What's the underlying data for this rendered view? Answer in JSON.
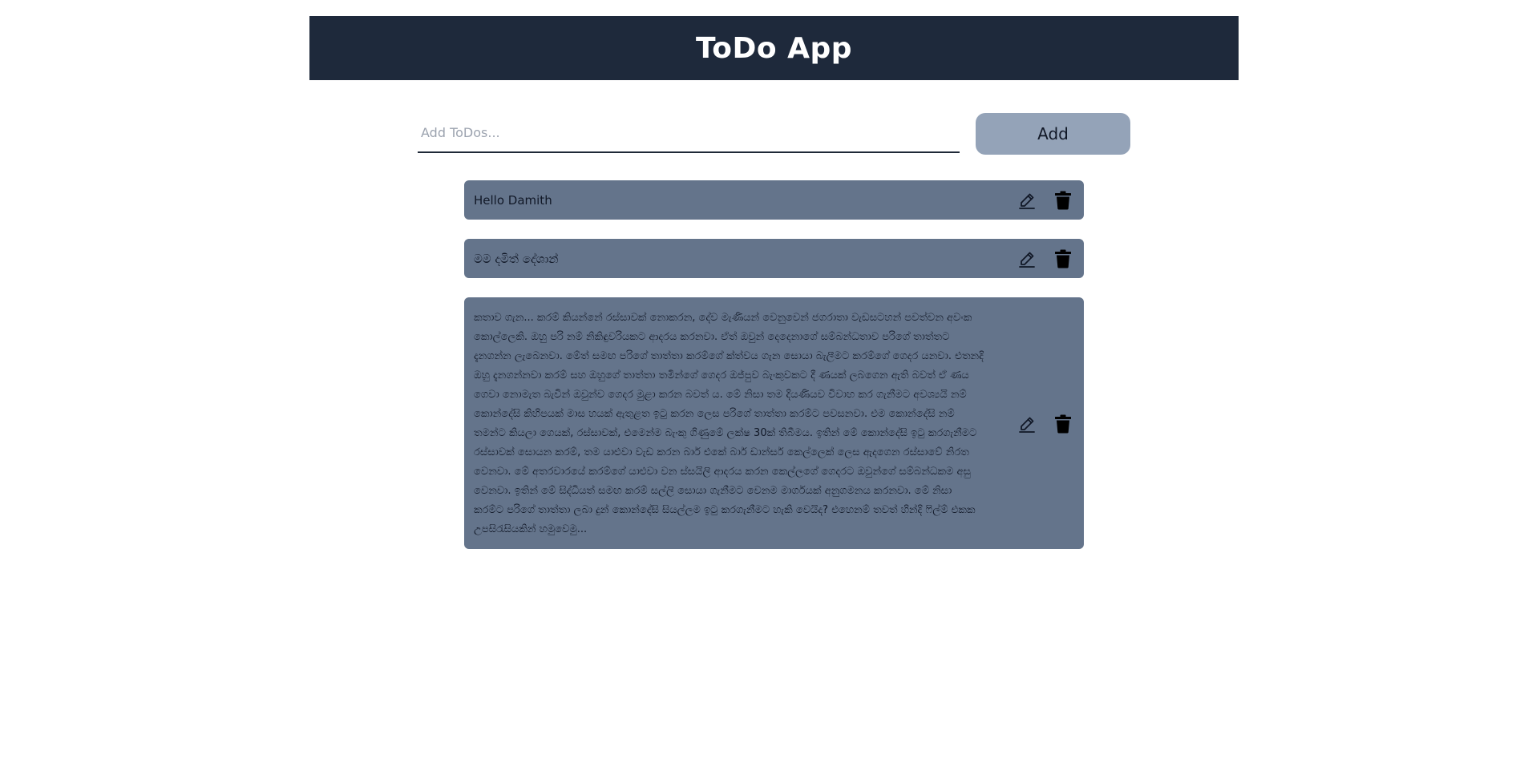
{
  "header": {
    "title": "ToDo App"
  },
  "add_form": {
    "placeholder": "Add ToDos...",
    "value": "",
    "button_label": "Add"
  },
  "todos": [
    {
      "text": "Hello Damith",
      "edit_icon": "pencil-icon",
      "delete_icon": "trash-icon"
    },
    {
      "text": "මම දමිත් දේශාන්",
      "edit_icon": "pencil-icon",
      "delete_icon": "trash-icon"
    },
    {
      "text": "කතාව ගැන... කරම් කියන්නේ රස්සාවක් නොකරන, දේව මැණියන් වෙනුවෙන් ජගරාතා වැඩසටහන් පවත්වන අවංක කොල්ලෙකි. ඔහු පරි නම් නිකිඳුවරියකට ආදරය කරනවා. ඒත් ඔවුන් දෙදෙනාගේ සම්බන්ධතාව පරිගේ තාත්තට දැනගන්න ලැබෙනවා. මේත් සමඟ පරිගේ තාත්තා කරම්ගේ ක්ත්වය ගැන සොයා බැලීමට කරම්ගේ ගෙදර යනවා. එතනදි ඔහු දැනගන්නවා කරම් සහ ඔහුගේ තාත්තා තමින්ගේ ගෙදර ඔජ්පුව බැංකුවකට දී ණයක් ලබගෙන ඇති බවත් ඒ ණය ගෙවා නොමැත බැවින් ඔවුන්ව ගෙදර මුළා කරන බවත් ය. මේ නිසා තම දියණියව විවාහ කර ගැනීමට අවශ්‍යයි නම් කොන්දේසි කිහිපයක් මාස හයක් ඇතුළත ඉටු කරන ලෙස පරිගේ තාත්තා කරම්ට පවසනවා. එම කොන්දේසි නම් තමන්ට කියලා ගෙයක්, රස්සාවක්, එමෙන්ම බැංකු ගිණුමේ ලක්ෂ 30ක් තිබීමය. ඉතින් මේ කොන්දේසි ඉටු කරගැනීමට රස්සාවක් සොයන කරම්, තම යාළුවා වැඩ කරන බාර් එකේ බාර් ඩාන්සර් කෙල්ලෙක් ලෙස ඇදගෙන රස්සාවේ නිරත වෙනවා. මේ අතරවාරයේ කරම්ගේ යාළුවා වන ස්සයිලි ආදරය කරන කෙල්ලගේ ගෙදරට ඔවුන්ගේ සම්බන්ධකම අසු වෙනවා. ඉතින් මේ සිද්ධියත් සමඟ කරම් සල්ලි සොයා ගැනීමට වෙනම මාර්ගයක් අනුගමනය කරනවා. මේ නිසා කරම්ට පරිගේ තාත්තා ලබා දුන් කොන්දේසි සියල්ලම ඉටු කරගැනීමට හැකි වෙයිද? එහෙනම් තවත් හින්දි ෆිල්ම් එකක උපසිරැසියකින් හමුවෙමු...",
      "edit_icon": "pencil-icon",
      "delete_icon": "trash-icon"
    }
  ],
  "colors": {
    "header_bg": "#1e293b",
    "add_button_bg": "#94a3b8",
    "todo_bg": "#64748b"
  }
}
